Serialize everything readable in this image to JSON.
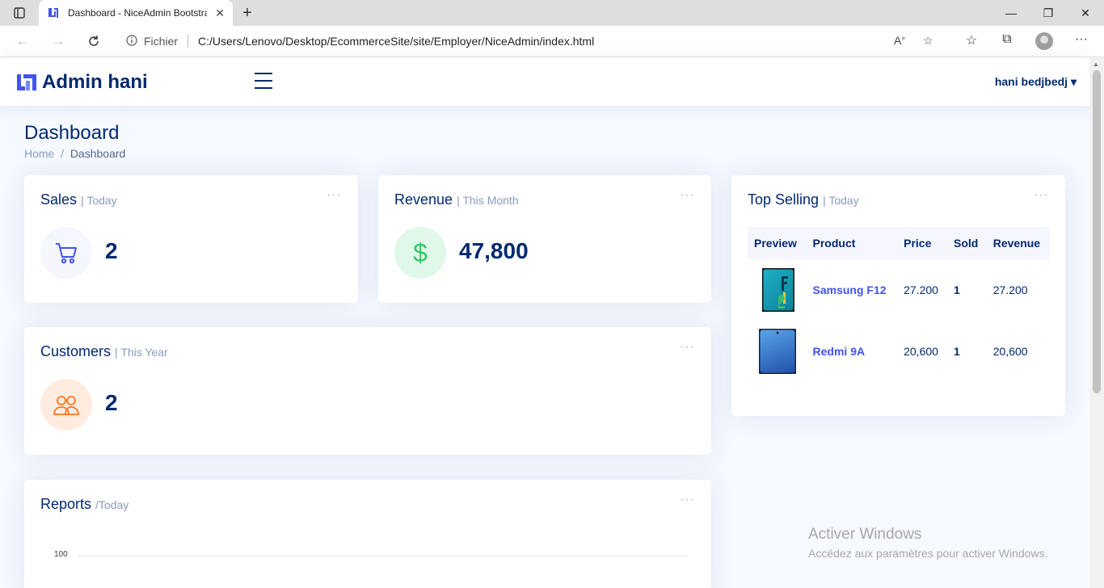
{
  "browser": {
    "tab_title": "Dashboard - NiceAdmin Bootstrap",
    "tab_close": "✕",
    "scheme_label": "Fichier",
    "url": "C:/Users/Lenovo/Desktop/EcommerceSite/site/Employer/NiceAdmin/index.html"
  },
  "header": {
    "brand": "Admin hani",
    "user_name": "hani bedjbedj",
    "caret": "▾"
  },
  "page": {
    "title": "Dashboard",
    "breadcrumb": {
      "home": "Home",
      "separator": "/",
      "current": "Dashboard"
    }
  },
  "cards": {
    "sales": {
      "title": "Sales",
      "period": "| Today",
      "value": "2",
      "dots": "···"
    },
    "revenue": {
      "title": "Revenue",
      "period": "| This Month",
      "currency_symbol": "$",
      "value": "47,800",
      "dots": "···"
    },
    "customers": {
      "title": "Customers",
      "period": "| This Year",
      "value": "2",
      "dots": "···"
    },
    "reports": {
      "title": "Reports",
      "period": "/Today",
      "dots": "···",
      "y_tick": "100"
    },
    "top_selling": {
      "title": "Top Selling",
      "period": "| Today",
      "dots": "···",
      "columns": [
        "Preview",
        "Product",
        "Price",
        "Sold",
        "Revenue"
      ],
      "rows": [
        {
          "product": "Samsung F12",
          "price": "27.200",
          "sold": "1",
          "revenue": "27.200"
        },
        {
          "product": "Redmi 9A",
          "price": "20,600",
          "sold": "1",
          "revenue": "20,600"
        }
      ]
    }
  },
  "watermark": {
    "line1": "Activer Windows",
    "line2": "Accédez aux paramètres pour activer Windows."
  },
  "colors": {
    "primary": "#012970",
    "accent": "#4154f1",
    "muted": "#899bbd",
    "revenue_bg": "#e0f8e9",
    "revenue_fg": "#2eca6a",
    "customers_bg": "#ffecdf",
    "customers_fg": "#ff771d",
    "sales_bg": "#f6f6fe"
  }
}
